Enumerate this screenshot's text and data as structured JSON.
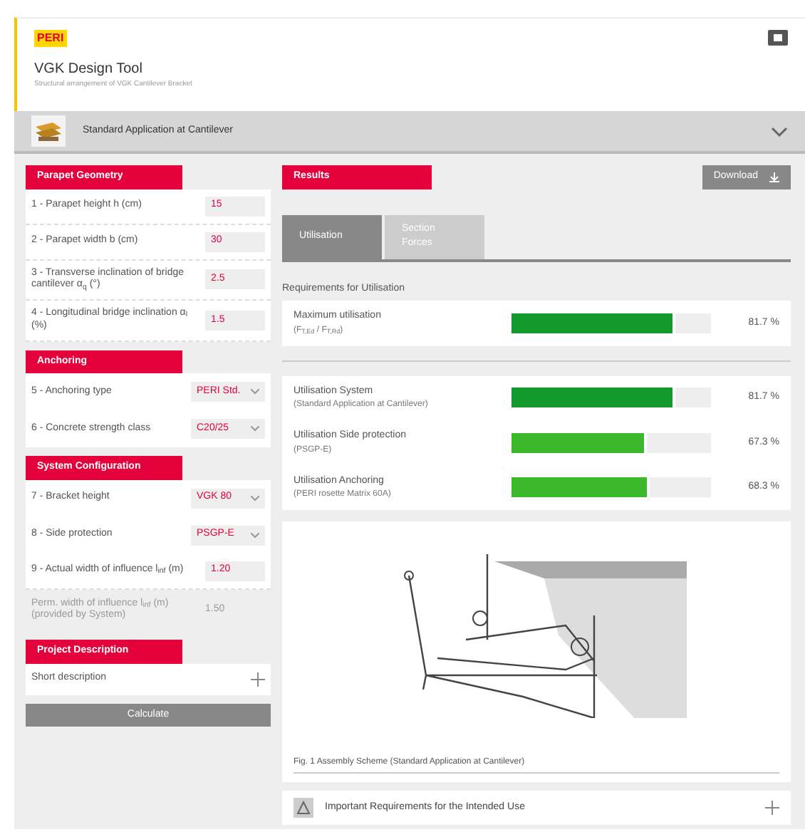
{
  "header": {
    "logo": "PERI",
    "title": "VGK Design Tool",
    "subtitle": "Structural arrangement of VGK Cantilever Bracket"
  },
  "application": {
    "label": "Standard Application at Cantilever",
    "expanded": false
  },
  "sections": [
    {
      "title": "Parapet Geometry",
      "fields": [
        {
          "kind": "input",
          "label": "1 - Parapet height h (cm)",
          "value": "15"
        },
        {
          "kind": "input",
          "label": "2 - Parapet width b (cm)",
          "value": "30"
        },
        {
          "kind": "input",
          "label": "3 - Transverse inclination of bridge cantilever α$_{q}$ (°)",
          "value": "2.5"
        },
        {
          "kind": "input",
          "label": "4 - Longitudinal bridge inclination α$_{l}$ (%)",
          "value": "1.5"
        }
      ]
    },
    {
      "title": "Anchoring",
      "fields": [
        {
          "kind": "select",
          "label": "5 - Anchoring type",
          "value": "PERI Std."
        },
        {
          "kind": "select",
          "label": "6 - Concrete strength class",
          "value": "C20/25"
        }
      ]
    },
    {
      "title": "System Configuration",
      "fields": [
        {
          "kind": "select",
          "label": "7 - Bracket height",
          "value": "VGK 80"
        },
        {
          "kind": "select",
          "label": "8 - Side protection",
          "value": "PSGP-E"
        },
        {
          "kind": "input",
          "label": "9 - Actual width of influence l$_{inf}$ (m)",
          "value": "1.20"
        },
        {
          "kind": "readonly",
          "label": "Perm. width of influence l$_{inf}$ (m) (provided by System)",
          "value": "1.50"
        }
      ]
    },
    {
      "title": "Project Description",
      "fields": [
        {
          "kind": "expand",
          "label": "Short description"
        }
      ]
    }
  ],
  "calculate_button": "Calculate",
  "results": {
    "title": "Results",
    "download_button": "Download",
    "tabs": [
      {
        "label": "Utilisation",
        "selected": true
      },
      {
        "label": "Section Forces",
        "selected": false
      }
    ],
    "group_title": "Requirements for Utilisation",
    "utilisation": [
      {
        "label": "Maximum utilisation",
        "sublabel": "(F$_{T,Ed}$ / F$_{T,Rd}$)",
        "level": 0.82,
        "reading": "81.7 %",
        "color": "#139a2d"
      }
    ],
    "details": [
      {
        "label": "Utilisation System",
        "sublabel": "(Standard Application at Cantilever)",
        "level": 0.82,
        "reading": "81.7 %",
        "color": "#139a2d"
      },
      {
        "label": "Utilisation Side protection",
        "sublabel": "(PSGP-E)",
        "level": 0.68,
        "reading": "67.3 %",
        "color": "#3cb82d"
      },
      {
        "label": "Utilisation Anchoring",
        "sublabel": "(PERI rosette Matrix 60A)",
        "level": 0.69,
        "reading": "68.3 %",
        "color": "#3cb82d"
      }
    ],
    "figure_caption": "Fig. 1 Assembly Scheme (Standard Application at Cantilever)",
    "requirements": "Important Requirements for the Intended Use"
  }
}
